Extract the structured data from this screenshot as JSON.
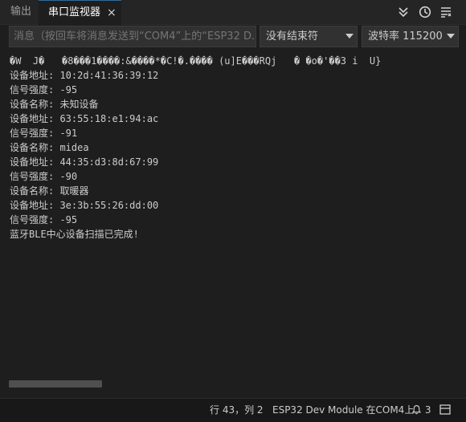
{
  "tabs": {
    "output_label": "输出",
    "serial_label": "串口监视器",
    "close_icon": "×"
  },
  "toolbar": {
    "collapse_icon": "chevron-double-down-icon",
    "timestamp_icon": "clock-icon",
    "menu_icon": "list-icon"
  },
  "controls": {
    "message_placeholder": "消息（按回车将消息发送到“COM4”上的“ESP32 D...",
    "line_ending": "没有结束符",
    "baud_rate": "波特率 115200"
  },
  "serial_lines": [
    "�W  J�   �8���1����:&����*�C!�.���� (u]E���RQj   � �o�'��3 i  U}",
    "设备地址: 10:2d:41:36:39:12",
    "信号强度: -95",
    "设备名称: 未知设备",
    "设备地址: 63:55:18:e1:94:ac",
    "信号强度: -91",
    "设备名称: midea",
    "设备地址: 44:35:d3:8d:67:99",
    "信号强度: -90",
    "设备名称: 取暖器",
    "设备地址: 3e:3b:55:26:dd:00",
    "信号强度: -95",
    "蓝牙BLE中心设备扫描已完成!"
  ],
  "status": {
    "cursor_position": "行 43，列 2",
    "board": "ESP32 Dev Module 在COM4上",
    "notifications": "3"
  },
  "colors": {
    "background": "#1e1e1e",
    "accent": "#0078d4",
    "status_bar": "#181818"
  }
}
